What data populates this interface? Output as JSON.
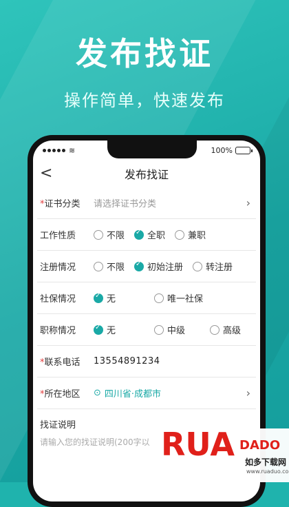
{
  "promo": {
    "headline": "发布找证",
    "subline": "操作简单，快速发布"
  },
  "status": {
    "wifi": "wifi-icon",
    "battery_text": "100%",
    "battery_level": 1.0
  },
  "nav": {
    "back": "<",
    "title": "发布找证"
  },
  "form": {
    "cert_type": {
      "required": "*",
      "label": "证书分类",
      "placeholder": "请选择证书分类",
      "chevron": "›"
    },
    "work_type": {
      "label": "工作性质",
      "options": [
        "不限",
        "全职",
        "兼职"
      ],
      "selected": "全职"
    },
    "register": {
      "label": "注册情况",
      "options": [
        "不限",
        "初始注册",
        "转注册"
      ],
      "selected": "初始注册"
    },
    "social": {
      "label": "社保情况",
      "options": [
        "无",
        "唯一社保"
      ],
      "selected": "无"
    },
    "title_level": {
      "label": "职称情况",
      "options": [
        "无",
        "中级",
        "高级"
      ],
      "selected": "无"
    },
    "phone": {
      "required": "*",
      "label": "联系电话",
      "value": "13554891234"
    },
    "region": {
      "required": "*",
      "label": "所在地区",
      "value": "四川省·成都市",
      "chevron": "›"
    },
    "desc": {
      "label": "找证说明",
      "placeholder": "请输入您的找证说明(200字以"
    }
  },
  "watermark": {
    "main": "RUA",
    "sub": "DADO",
    "cn": "如多下载网",
    "url": "www.ruaduo.com"
  },
  "colors": {
    "accent": "#1aa9a6",
    "required": "#e23c3c",
    "background": "#1fb3ad"
  }
}
